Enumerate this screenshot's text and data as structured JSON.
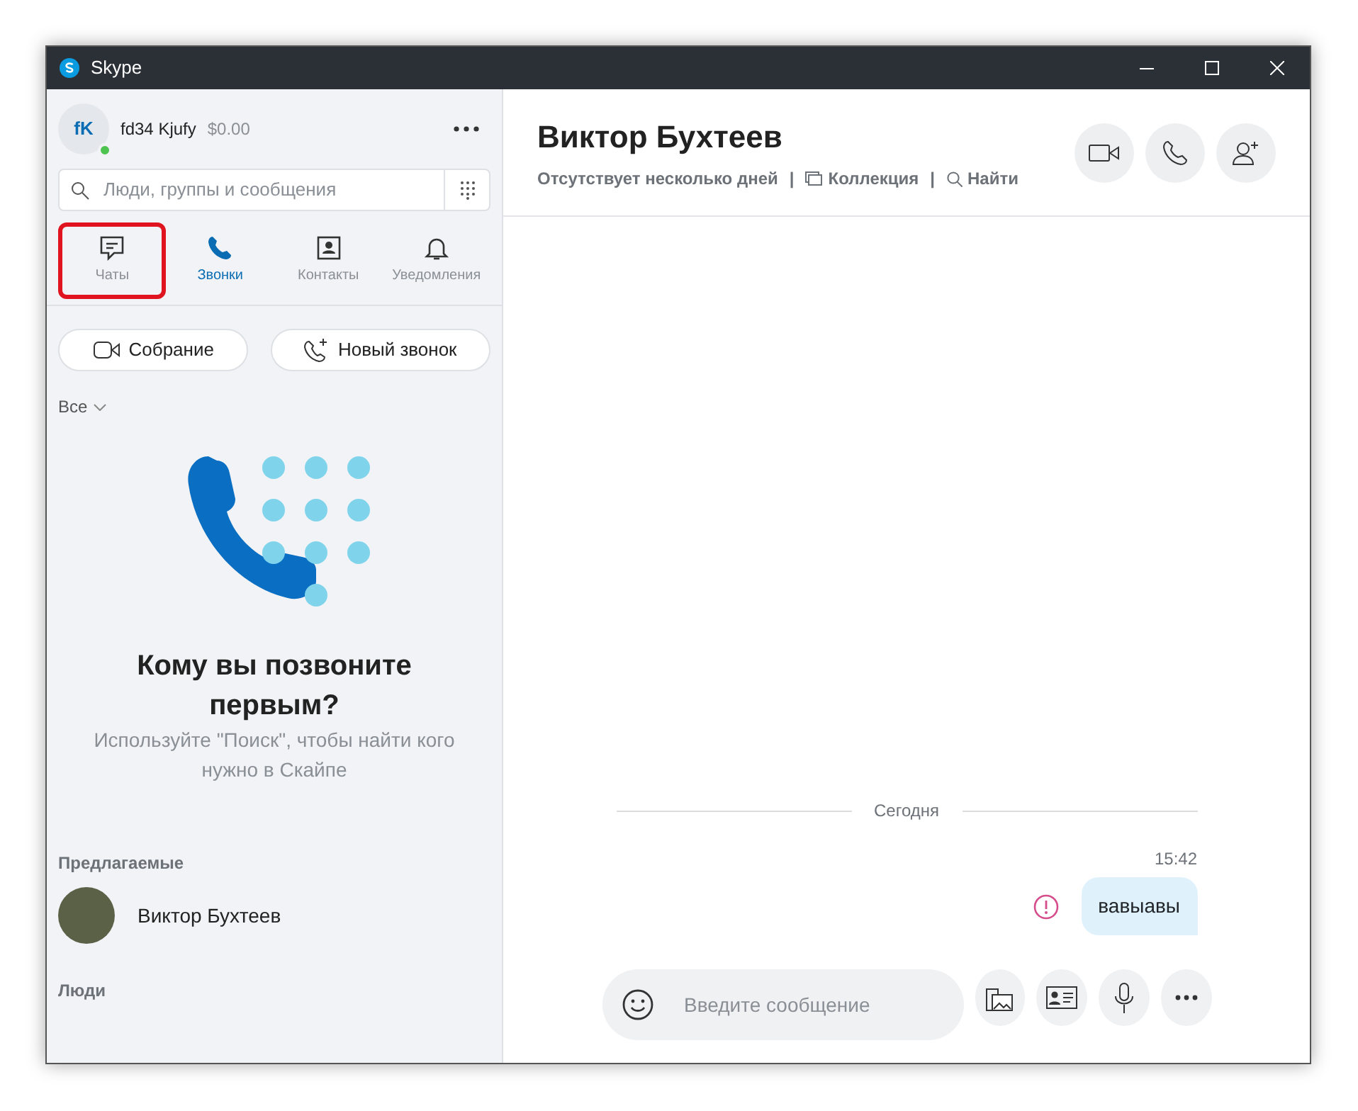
{
  "window": {
    "title": "Skype"
  },
  "profile": {
    "initials": "fK",
    "name": "fd34 Kjufy",
    "balance": "$0.00",
    "online": true
  },
  "search": {
    "placeholder": "Люди, группы и сообщения"
  },
  "tabs": [
    {
      "label": "Чаты",
      "kind": "chats",
      "selected": false,
      "highlighted": true
    },
    {
      "label": "Звонки",
      "kind": "calls",
      "selected": true,
      "highlighted": false
    },
    {
      "label": "Контакты",
      "kind": "contacts",
      "selected": false,
      "highlighted": false
    },
    {
      "label": "Уведомления",
      "kind": "notifications",
      "selected": false,
      "highlighted": false
    }
  ],
  "actions": [
    {
      "label": "Собрание",
      "kind": "meeting"
    },
    {
      "label": "Новый звонок",
      "kind": "call"
    }
  ],
  "filter": {
    "label": "Все"
  },
  "empty_state": {
    "heading": "Кому вы позвоните первым?",
    "text": "Используйте \"Поиск\", чтобы найти кого нужно в Скайпе"
  },
  "suggested": {
    "title": "Предлагаемые",
    "contacts": [
      {
        "name": "Виктор Бухтеев"
      }
    ]
  },
  "people": {
    "title": "Люди"
  },
  "chat": {
    "name": "Виктор Бухтеев",
    "status": "Отсутствует несколько дней",
    "links": [
      {
        "separator": "|",
        "label": "Коллекция",
        "kind": "gallery"
      },
      {
        "separator": "|",
        "label": "Найти",
        "kind": "search"
      }
    ],
    "date_divider": "Сегодня",
    "messages": [
      {
        "time": "15:42",
        "text": "вавыавы",
        "failed": true
      }
    ],
    "composer": {
      "placeholder": "Введите сообщение"
    }
  }
}
